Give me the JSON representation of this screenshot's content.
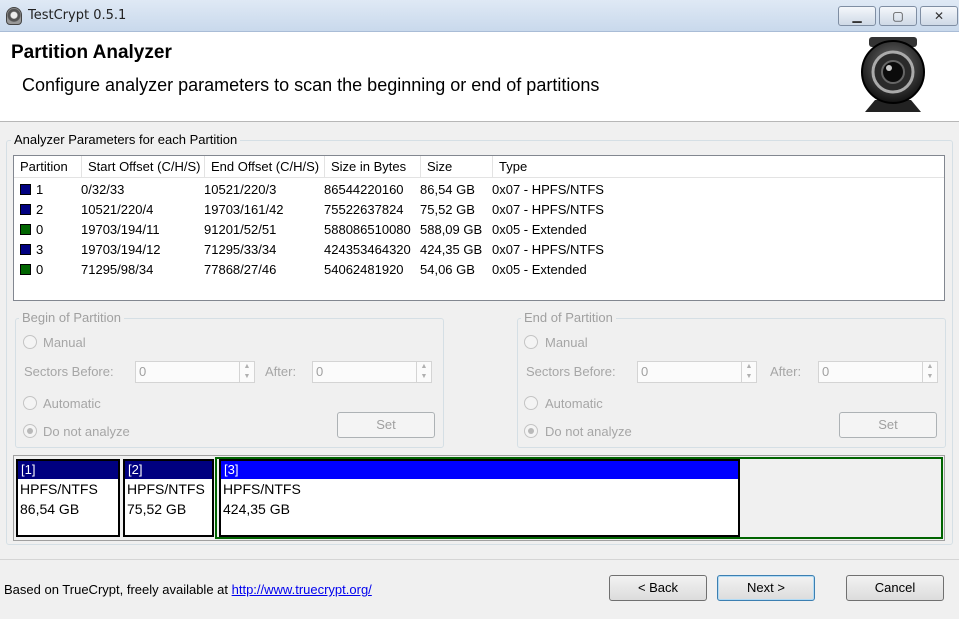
{
  "window": {
    "title": "TestCrypt 0.5.1",
    "minimize": "▁",
    "maximize": "▢",
    "close": "✕"
  },
  "header": {
    "title": "Partition Analyzer",
    "subtitle": "Configure analyzer parameters to scan the beginning or end of partitions"
  },
  "params_group": {
    "label": "Analyzer Parameters for each Partition"
  },
  "table": {
    "columns": [
      "Partition",
      "Start Offset (C/H/S)",
      "End Offset (C/H/S)",
      "Size in Bytes",
      "Size",
      "Type"
    ],
    "rows": [
      {
        "partition": "1",
        "color": "#000080",
        "start": "0/32/33",
        "end": "10521/220/3",
        "bytes": "86544220160",
        "size": "86,54 GB",
        "type": "0x07 - HPFS/NTFS"
      },
      {
        "partition": "2",
        "color": "#000080",
        "start": "10521/220/4",
        "end": "19703/161/42",
        "bytes": "75522637824",
        "size": "75,52 GB",
        "type": "0x07 - HPFS/NTFS"
      },
      {
        "partition": "0",
        "color": "#006400",
        "start": "19703/194/11",
        "end": "91201/52/51",
        "bytes": "588086510080",
        "size": "588,09 GB",
        "type": "0x05 - Extended"
      },
      {
        "partition": "3",
        "color": "#000080",
        "start": "19703/194/12",
        "end": "71295/33/34",
        "bytes": "424353464320",
        "size": "424,35 GB",
        "type": "0x07 - HPFS/NTFS"
      },
      {
        "partition": "0",
        "color": "#006400",
        "start": "71295/98/34",
        "end": "77868/27/46",
        "bytes": "54062481920",
        "size": "54,06 GB",
        "type": "0x05 - Extended"
      }
    ]
  },
  "begin": {
    "label": "Begin of Partition",
    "manual": "Manual",
    "sectors_before": "Sectors Before:",
    "before_value": "0",
    "after": "After:",
    "after_value": "0",
    "automatic": "Automatic",
    "do_not": "Do not analyze",
    "set": "Set"
  },
  "end": {
    "label": "End of Partition",
    "manual": "Manual",
    "sectors_before": "Sectors Before:",
    "before_value": "0",
    "after": "After:",
    "after_value": "0",
    "automatic": "Automatic",
    "do_not": "Do not analyze",
    "set": "Set"
  },
  "map": {
    "parts": [
      {
        "id": "[1]",
        "fs": "HPFS/NTFS",
        "size": "86,54 GB"
      },
      {
        "id": "[2]",
        "fs": "HPFS/NTFS",
        "size": "75,52 GB"
      },
      {
        "id": "[3]",
        "fs": "HPFS/NTFS",
        "size": "424,35 GB"
      }
    ],
    "selected_color": "#0000ff",
    "normal_color": "#000080",
    "extended_color": "#006400"
  },
  "footer": {
    "text": "Based on TrueCrypt, freely available at ",
    "link": "http://www.truecrypt.org/",
    "back": "< Back",
    "next": "Next >",
    "cancel": "Cancel"
  }
}
